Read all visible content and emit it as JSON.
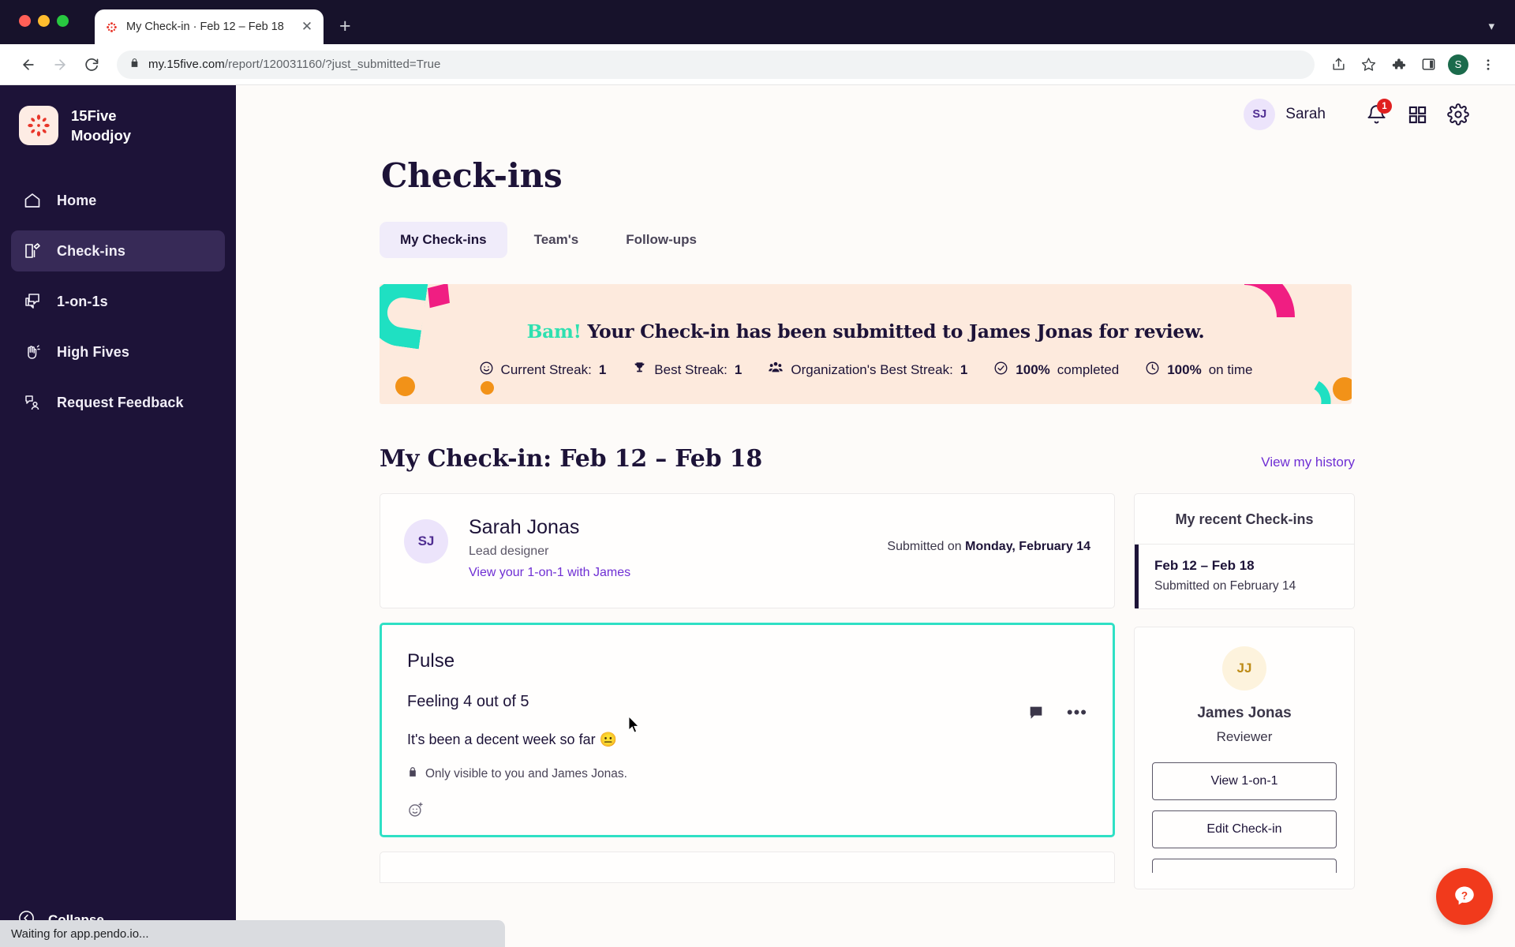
{
  "browser": {
    "tab_title": "My Check-in · Feb 12 – Feb 18",
    "tab_close": "✕",
    "new_tab": "+",
    "url_visible": "my.15five.com/report/120031160/?just_submitted=True",
    "url_host": "my.15five.com",
    "url_path": "/report/120031160/?just_submitted=True",
    "profile_initial": "S",
    "status_text": "Waiting for app.pendo.io..."
  },
  "sidebar": {
    "brand_name": "15Five",
    "brand_org": "Moodjoy",
    "items": [
      {
        "label": "Home",
        "icon": "home-icon",
        "active": false
      },
      {
        "label": "Check-ins",
        "icon": "checkin-icon",
        "active": true
      },
      {
        "label": "1-on-1s",
        "icon": "chat-icon",
        "active": false
      },
      {
        "label": "High Fives",
        "icon": "high-five-icon",
        "active": false
      },
      {
        "label": "Request Feedback",
        "icon": "request-feedback-icon",
        "active": false
      }
    ],
    "collapse_label": "Collapse"
  },
  "topbar": {
    "avatar_initials": "SJ",
    "user_name": "Sarah",
    "notification_count": "1"
  },
  "page": {
    "title": "Check-ins",
    "tabs": [
      {
        "label": "My Check-ins",
        "active": true
      },
      {
        "label": "Team's",
        "active": false
      },
      {
        "label": "Follow-ups",
        "active": false
      }
    ]
  },
  "banner": {
    "bam": "Bam!",
    "message": "Your Check-in has been submitted to James Jonas for review.",
    "stats": [
      {
        "icon": "smiley-icon",
        "label": "Current Streak:",
        "value": "1"
      },
      {
        "icon": "trophy-icon",
        "label": "Best Streak:",
        "value": "1"
      },
      {
        "icon": "people-icon",
        "label": "Organization's Best Streak:",
        "value": "1"
      },
      {
        "icon": "check-circle-icon",
        "label": "completed",
        "value": "100%"
      },
      {
        "icon": "clock-icon",
        "label": "on time",
        "value": "100%"
      }
    ],
    "bg_color": "#fdeadd",
    "accent_teal": "#1fe0c2",
    "accent_pink": "#f01e82",
    "accent_orange": "#f29218"
  },
  "section": {
    "title": "My Check-in: Feb 12 – Feb 18",
    "history_link": "View my history"
  },
  "person_card": {
    "avatar_initials": "SJ",
    "name": "Sarah Jonas",
    "role": "Lead designer",
    "link": "View your 1-on-1 with James",
    "submitted_prefix": "Submitted on ",
    "submitted_date": "Monday, February 14"
  },
  "pulse_card": {
    "title": "Pulse",
    "feeling": "Feeling 4 out of 5",
    "note": "It's been a decent week so far 😐",
    "privacy": "Only visible to you and James Jonas.",
    "border_color": "#2fe0c5"
  },
  "recent": {
    "heading": "My recent Check-ins",
    "items": [
      {
        "range": "Feb 12 – Feb 18",
        "sub": "Submitted on February 14"
      }
    ]
  },
  "reviewer": {
    "avatar_initials": "JJ",
    "name": "James Jonas",
    "role": "Reviewer",
    "buttons": [
      "View 1-on-1",
      "Edit Check-in"
    ]
  },
  "help": {
    "label": "?"
  }
}
